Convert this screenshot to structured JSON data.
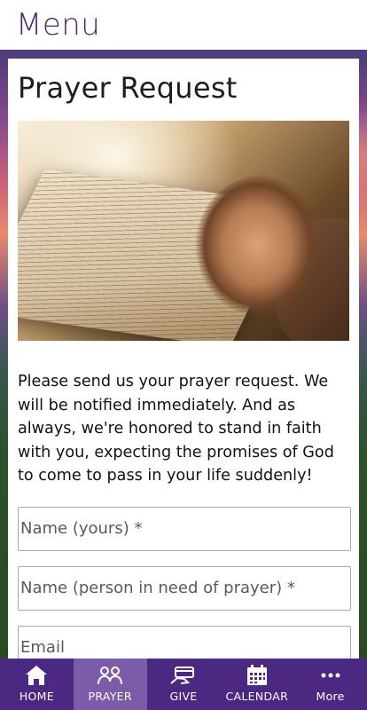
{
  "header": {
    "title": "Menu"
  },
  "page": {
    "title": "Prayer Request",
    "description": "Please send us your prayer request. We will be notified immediately. And as always, we're honored to stand in faith with you, expecting the promises of God to come to pass in your life suddenly!"
  },
  "form": {
    "name_placeholder": "Name (yours) *",
    "person_placeholder": "Name (person in need of prayer) *",
    "email_placeholder": "Email"
  },
  "tabs": [
    {
      "label": "HOME",
      "icon": "home-icon"
    },
    {
      "label": "PRAYER",
      "icon": "prayer-icon",
      "active": true
    },
    {
      "label": "GIVE",
      "icon": "give-icon"
    },
    {
      "label": "CALENDAR",
      "icon": "calendar-icon"
    },
    {
      "label": "More",
      "icon": "more-icon"
    }
  ],
  "colors": {
    "header_title": "#4a2a6b",
    "tabbar_bg": "#4b2882",
    "tab_active_bg": "#7c5ba8"
  }
}
